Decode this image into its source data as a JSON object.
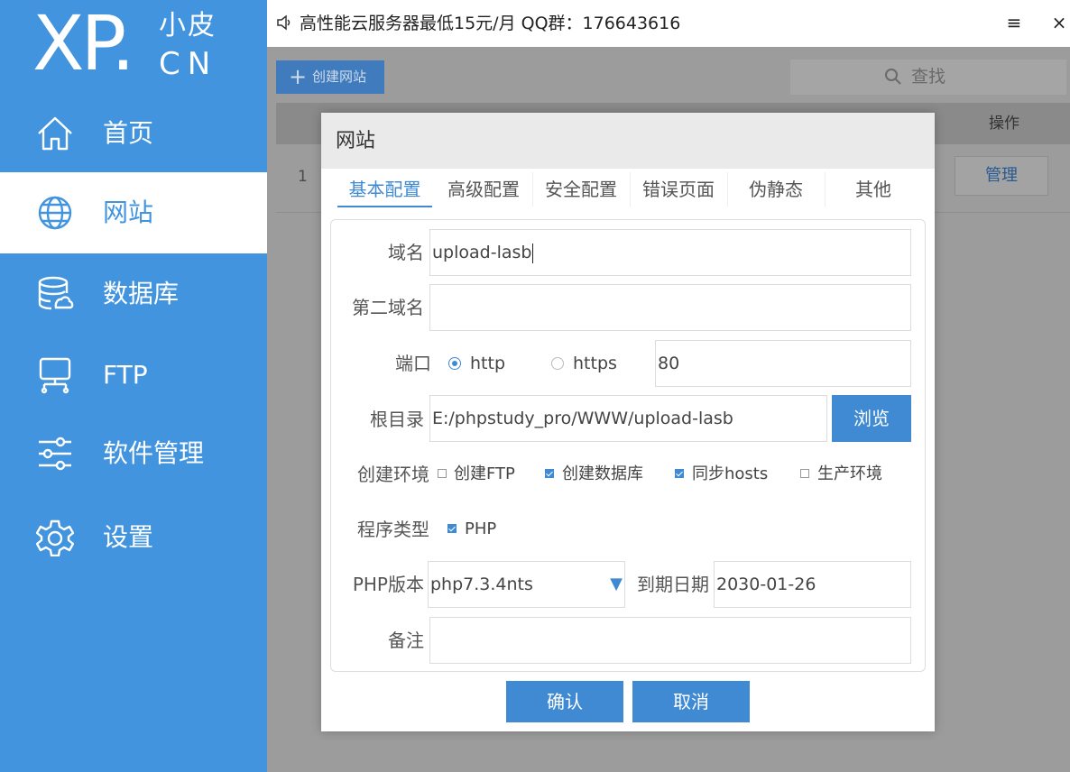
{
  "logo": {
    "main": "XP.",
    "sub": "小皮",
    "cn": "CN"
  },
  "nav": [
    {
      "label": "首页",
      "icon": "home-icon",
      "active": false
    },
    {
      "label": "网站",
      "icon": "globe-icon",
      "active": true
    },
    {
      "label": "数据库",
      "icon": "database-icon",
      "active": false
    },
    {
      "label": "FTP",
      "icon": "ftp-icon",
      "active": false
    },
    {
      "label": "软件管理",
      "icon": "sliders-icon",
      "active": false
    },
    {
      "label": "设置",
      "icon": "gear-icon",
      "active": false
    }
  ],
  "topbar": {
    "notice": "高性能云服务器最低15元/月 QQ群：176643616",
    "menu_glyph": "≡",
    "close_glyph": "×"
  },
  "toolbar": {
    "create_label": "创建网站",
    "plus": "+",
    "search_placeholder": "查找"
  },
  "table": {
    "header_action": "操作",
    "rows": [
      {
        "index": "1",
        "action": "管理"
      }
    ]
  },
  "modal": {
    "title": "网站",
    "tabs": [
      "基本配置",
      "高级配置",
      "安全配置",
      "错误页面",
      "伪静态",
      "其他"
    ],
    "active_tab": 0,
    "form": {
      "domain_label": "域名",
      "domain_value": "upload-lasb",
      "second_domain_label": "第二域名",
      "second_domain_value": "",
      "port_label": "端口",
      "http_label": "http",
      "https_label": "https",
      "protocol_selected": "http",
      "port_value": "80",
      "root_label": "根目录",
      "root_value": "E:/phpstudy_pro/WWW/upload-lasb",
      "browse_label": "浏览",
      "env_label": "创建环境",
      "env_options": [
        {
          "label": "创建FTP",
          "checked": false
        },
        {
          "label": "创建数据库",
          "checked": true
        },
        {
          "label": "同步hosts",
          "checked": true
        },
        {
          "label": "生产环境",
          "checked": false
        }
      ],
      "program_label": "程序类型",
      "program_option": {
        "label": "PHP",
        "checked": true
      },
      "php_version_label": "PHP版本",
      "php_version_value": "php7.3.4nts",
      "expiry_label": "到期日期",
      "expiry_value": "2030-01-26",
      "note_label": "备注",
      "note_value": ""
    },
    "confirm_label": "确认",
    "cancel_label": "取消"
  },
  "colors": {
    "accent": "#4294df",
    "primary_button": "#3f8ad3",
    "overlay_gray": "#9c9c9c"
  }
}
